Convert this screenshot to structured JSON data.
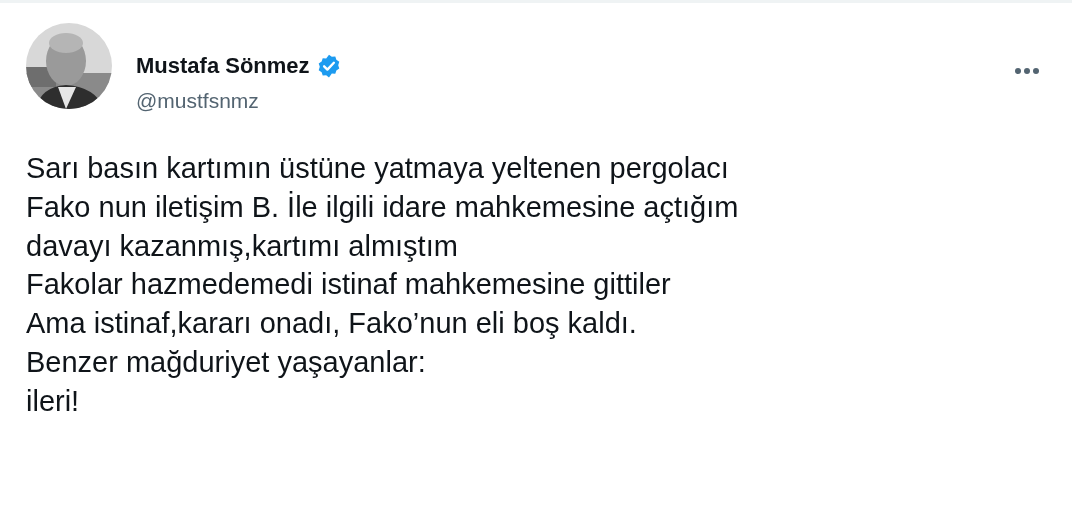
{
  "tweet": {
    "author": {
      "name": "Mustafa Sönmez",
      "verified": true,
      "handle": "@mustfsnmz"
    },
    "text": "Sarı basın kartımın üstüne yatmaya yeltenen pergolacı\nFako nun iletişim B. İle ilgili idare mahkemesine açtığım\ndavayı kazanmış,kartımı almıştım\nFakolar hazmedemedi istinaf mahkemesine gittiler\nAma istinaf,kararı onadı, Fako’nun eli boş kaldı.\nBenzer mağduriyet yaşayanlar:\nileri!"
  }
}
